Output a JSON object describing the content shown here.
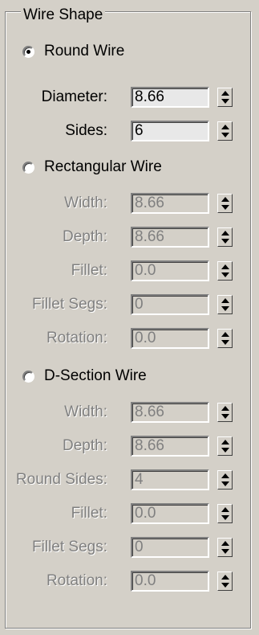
{
  "group_title": "Wire Shape",
  "round": {
    "label": "Round Wire",
    "checked": true,
    "fields": [
      {
        "label": "Diameter:",
        "value": "8.66",
        "enabled": true
      },
      {
        "label": "Sides:",
        "value": "6",
        "enabled": true
      }
    ]
  },
  "rectangular": {
    "label": "Rectangular Wire",
    "checked": false,
    "fields": [
      {
        "label": "Width:",
        "value": "8.66",
        "enabled": false
      },
      {
        "label": "Depth:",
        "value": "8.66",
        "enabled": false
      },
      {
        "label": "Fillet:",
        "value": "0.0",
        "enabled": false
      },
      {
        "label": "Fillet Segs:",
        "value": "0",
        "enabled": false
      },
      {
        "label": "Rotation:",
        "value": "0.0",
        "enabled": false
      }
    ]
  },
  "dsection": {
    "label": "D-Section Wire",
    "checked": false,
    "fields": [
      {
        "label": "Width:",
        "value": "8.66",
        "enabled": false
      },
      {
        "label": "Depth:",
        "value": "8.66",
        "enabled": false
      },
      {
        "label": "Round Sides:",
        "value": "4",
        "enabled": false
      },
      {
        "label": "Fillet:",
        "value": "0.0",
        "enabled": false
      },
      {
        "label": "Fillet Segs:",
        "value": "0",
        "enabled": false
      },
      {
        "label": "Rotation:",
        "value": "0.0",
        "enabled": false
      }
    ]
  }
}
